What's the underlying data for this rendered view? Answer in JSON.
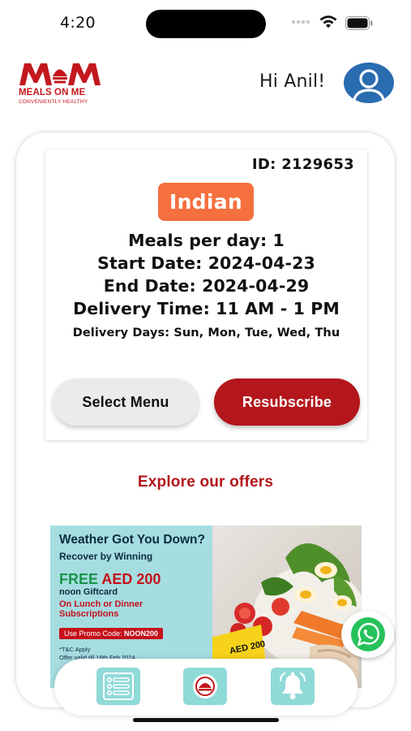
{
  "status_bar": {
    "time": "4:20"
  },
  "header": {
    "logo": {
      "word": "MOM",
      "name": "MEALS ON ME",
      "tagline": "CONVENIENTLY HEALTHY"
    },
    "greeting": "Hi Anil!"
  },
  "subscription": {
    "id_text": "ID: 2129653",
    "cuisine": "Indian",
    "meals_per_day": "Meals per day: 1",
    "start_date": "Start Date: 2024-04-23",
    "end_date": "End Date: 2024-04-29",
    "delivery_time": "Delivery Time: 11 AM - 1 PM",
    "delivery_days": "Delivery Days: Sun, Mon, Tue, Wed, Thu",
    "select_menu_label": "Select Menu",
    "resubscribe_label": "Resubscribe"
  },
  "offers": {
    "heading": "Explore our offers",
    "banner": {
      "title": "Weather Got You Down?",
      "subtitle": "Recover by Winning",
      "free": "FREE",
      "amount": "AED 200",
      "gift": "noon Giftcard",
      "lunch_line1": "On Lunch or Dinner",
      "lunch_line2": "Subscriptions",
      "promo_prefix": "Use Promo Code:",
      "promo_code": "NOON200",
      "tc": "*T&C Apply",
      "offer_note": "Offer valid till 16th Feb 2024",
      "card_amount": "AED 200"
    }
  },
  "bottom_nav": {
    "items": [
      {
        "icon": "list-icon"
      },
      {
        "icon": "logo-icon"
      },
      {
        "icon": "bell-icon"
      }
    ]
  },
  "colors": {
    "brand_red": "#b3161b",
    "cuisine_orange": "#f4703f",
    "nav_teal": "#8fdad7",
    "avatar_blue": "#2a6cb0"
  }
}
